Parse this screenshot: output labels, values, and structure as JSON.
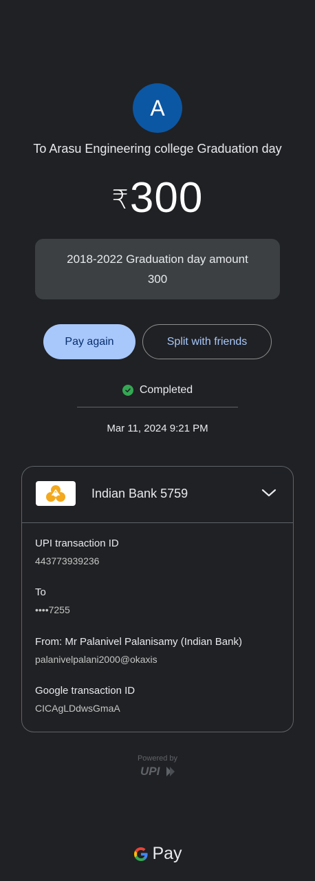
{
  "header": {
    "avatar_letter": "A",
    "payee": "To Arasu Engineering college Graduation day",
    "currency_symbol": "₹",
    "amount": "300",
    "note_line1": "2018-2022 Graduation day amount",
    "note_line2": "300"
  },
  "actions": {
    "pay_again": "Pay again",
    "split": "Split with friends"
  },
  "status": {
    "text": "Completed",
    "color": "#34a853",
    "datetime": "Mar 11, 2024 9:21 PM"
  },
  "bank": {
    "name": "Indian Bank 5759",
    "logo_icon": "indian-bank-logo"
  },
  "details": [
    {
      "label": "UPI transaction ID",
      "value": "443773939236"
    },
    {
      "label": "To",
      "value": "••••7255"
    },
    {
      "label": "From: Mr Palanivel Palanisamy (Indian Bank)",
      "value": "palanivelpalani2000@okaxis"
    },
    {
      "label": "Google transaction ID",
      "value": "CICAgLDdwsGmaA"
    }
  ],
  "footer": {
    "powered_by": "Powered by",
    "upi_logo_text": "UPI",
    "brand_pay": "Pay"
  },
  "colors": {
    "background": "#202124",
    "primary_button": "#a8c7fa",
    "avatar": "#0b57a4"
  }
}
